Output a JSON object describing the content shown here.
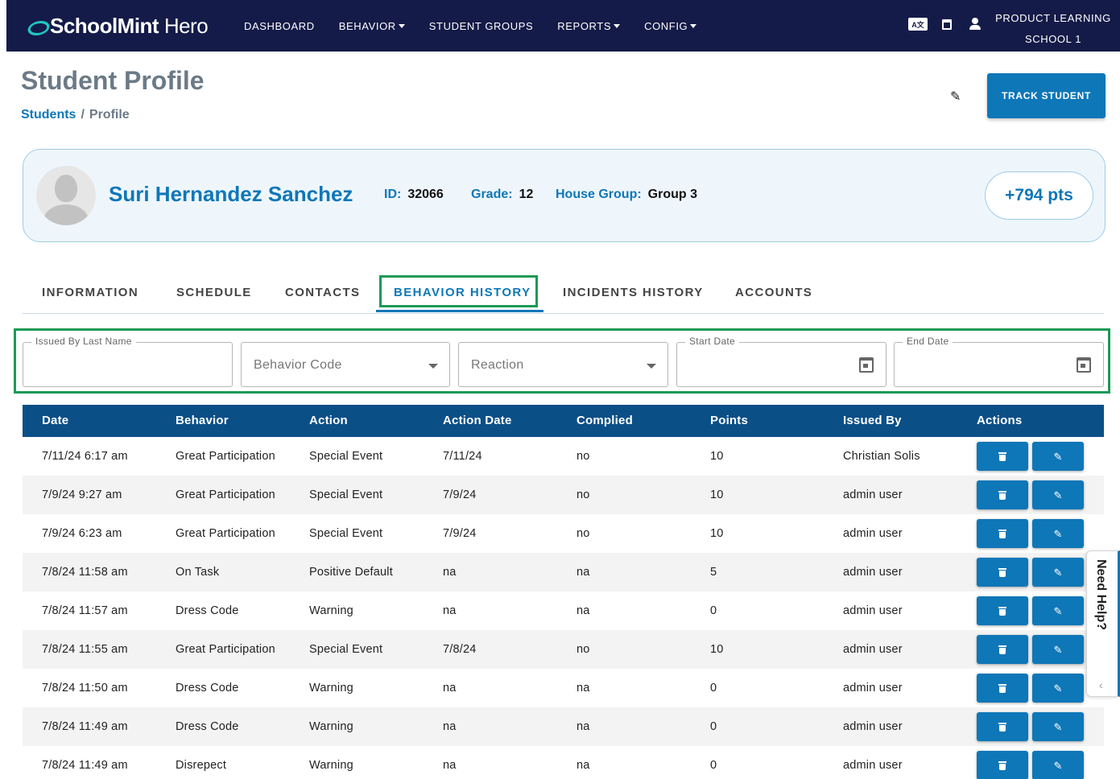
{
  "app": {
    "logo_brand": "SchoolMint",
    "logo_product": " Hero"
  },
  "nav": {
    "items": [
      {
        "label": "DASHBOARD",
        "dropdown": false
      },
      {
        "label": "BEHAVIOR",
        "dropdown": true
      },
      {
        "label": "STUDENT GROUPS",
        "dropdown": false
      },
      {
        "label": "REPORTS",
        "dropdown": true
      },
      {
        "label": "CONFIG",
        "dropdown": true
      }
    ],
    "translate_icon_text": "A文",
    "org_line1": "PRODUCT LEARNING",
    "org_line2": "SCHOOL 1"
  },
  "page": {
    "title": "Student Profile",
    "breadcrumb_link": "Students",
    "breadcrumb_sep": "/",
    "breadcrumb_current": "Profile",
    "track_button": "TRACK STUDENT"
  },
  "student": {
    "name": "Suri Hernandez Sanchez",
    "id_label": "ID:",
    "id": "32066",
    "grade_label": "Grade:",
    "grade": "12",
    "house_label": "House Group:",
    "house": "Group 3",
    "points": "+794 pts"
  },
  "tabs": [
    {
      "label": "INFORMATION",
      "active": false
    },
    {
      "label": "SCHEDULE",
      "active": false
    },
    {
      "label": "CONTACTS",
      "active": false
    },
    {
      "label": "BEHAVIOR HISTORY",
      "active": true
    },
    {
      "label": "INCIDENTS HISTORY",
      "active": false
    },
    {
      "label": "ACCOUNTS",
      "active": false
    }
  ],
  "filters": {
    "issued_by_label": "Issued By Last Name",
    "issued_by_value": "",
    "behavior_code_placeholder": "Behavior Code",
    "reaction_placeholder": "Reaction",
    "start_date_label": "Start Date",
    "end_date_label": "End Date"
  },
  "table": {
    "columns": [
      "Date",
      "Behavior",
      "Action",
      "Action Date",
      "Complied",
      "Points",
      "Issued By",
      "Actions"
    ],
    "rows": [
      [
        "7/11/24 6:17 am",
        "Great Participation",
        "Special Event",
        "7/11/24",
        "no",
        "10",
        "Christian Solis"
      ],
      [
        "7/9/24 9:27 am",
        "Great Participation",
        "Special Event",
        "7/9/24",
        "no",
        "10",
        "admin user"
      ],
      [
        "7/9/24 6:23 am",
        "Great Participation",
        "Special Event",
        "7/9/24",
        "no",
        "10",
        "admin user"
      ],
      [
        "7/8/24 11:58 am",
        "On Task",
        "Positive Default",
        "na",
        "na",
        "5",
        "admin user"
      ],
      [
        "7/8/24 11:57 am",
        "Dress Code",
        "Warning",
        "na",
        "na",
        "0",
        "admin user"
      ],
      [
        "7/8/24 11:55 am",
        "Great Participation",
        "Special Event",
        "7/8/24",
        "no",
        "10",
        "admin user"
      ],
      [
        "7/8/24 11:50 am",
        "Dress Code",
        "Warning",
        "na",
        "na",
        "0",
        "admin user"
      ],
      [
        "7/8/24 11:49 am",
        "Dress Code",
        "Warning",
        "na",
        "na",
        "0",
        "admin user"
      ],
      [
        "7/8/24 11:49 am",
        "Disrepect",
        "Warning",
        "na",
        "na",
        "0",
        "admin user"
      ]
    ]
  },
  "help": {
    "label": "Need Help?"
  },
  "colors": {
    "navbar": "#141b48",
    "primary": "#0e77b8",
    "table_header": "#0b4f87",
    "highlight": "#1a9a56"
  }
}
